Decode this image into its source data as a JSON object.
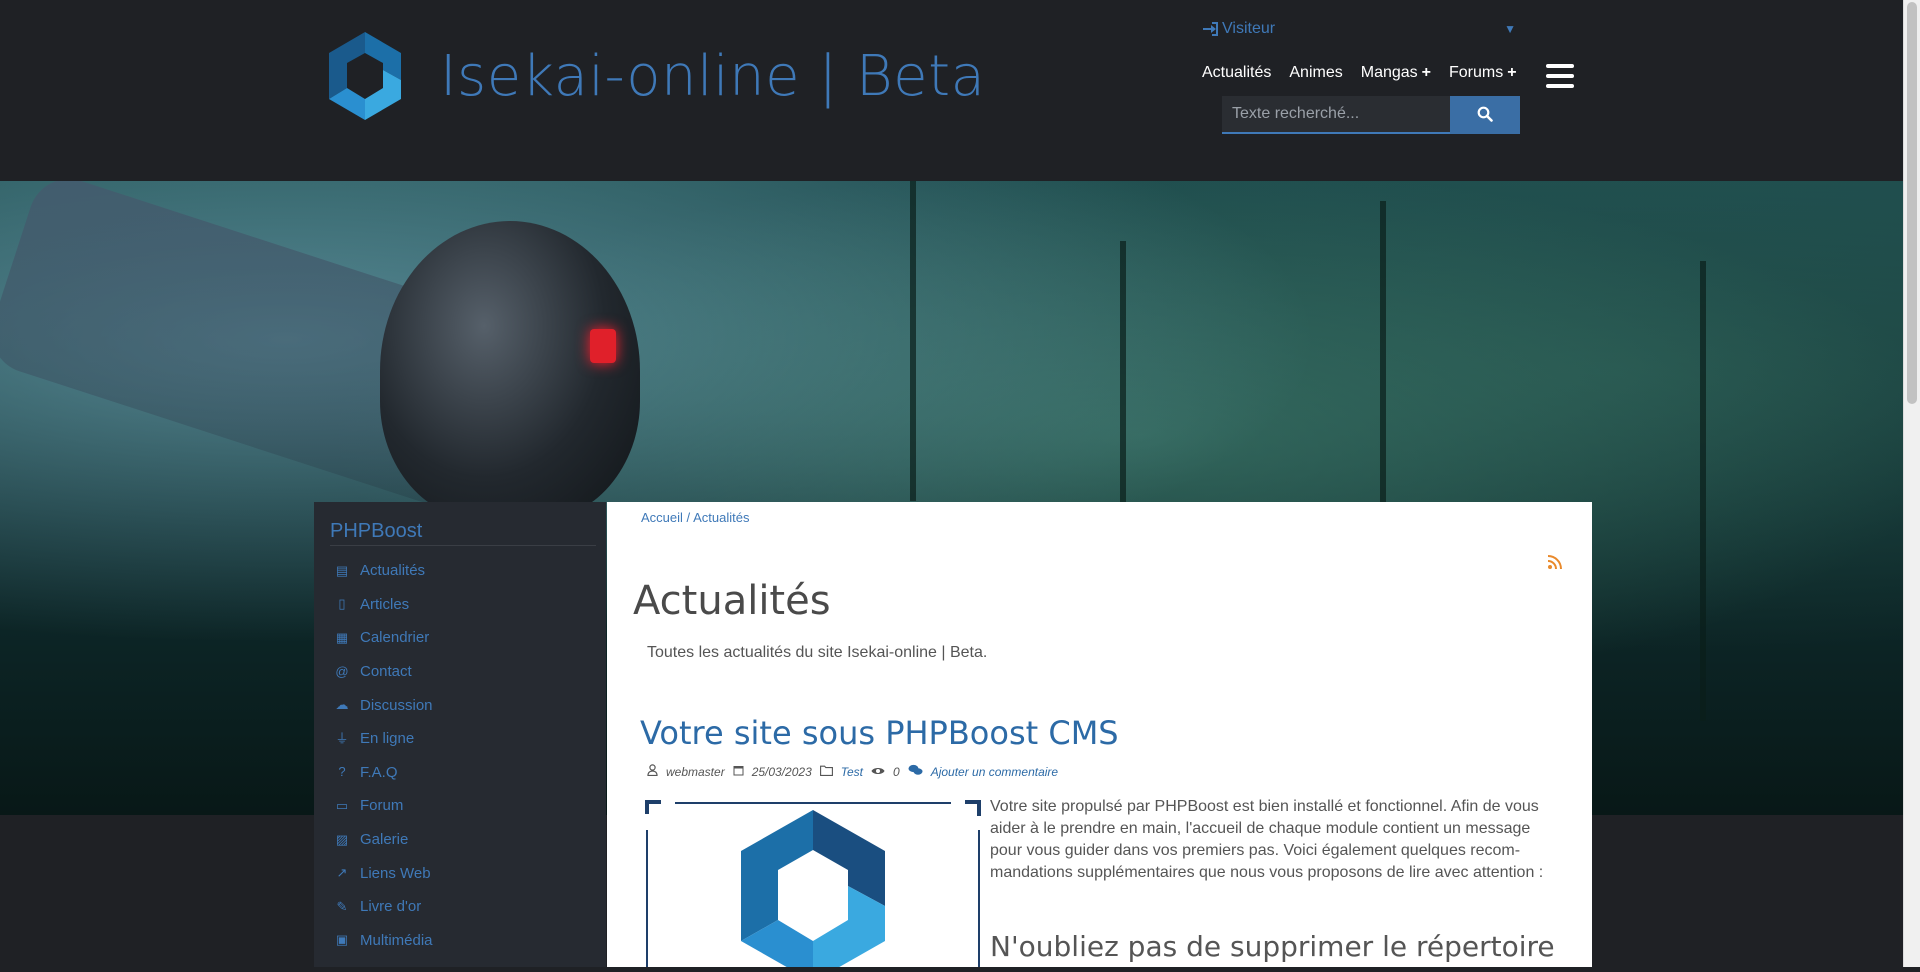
{
  "site": {
    "title": "Isekai-online | Beta"
  },
  "user_menu": {
    "label": "Visiteur"
  },
  "topnav": [
    {
      "label": "Actualités",
      "plus": ""
    },
    {
      "label": "Animes",
      "plus": ""
    },
    {
      "label": "Mangas",
      "plus": "+"
    },
    {
      "label": "Forums",
      "plus": "+"
    }
  ],
  "search": {
    "placeholder": "Texte recherché..."
  },
  "sidebar": {
    "title": "PHPBoost",
    "items": [
      {
        "label": "Actualités",
        "icon": "newspaper-icon"
      },
      {
        "label": "Articles",
        "icon": "file-icon"
      },
      {
        "label": "Calendrier",
        "icon": "calendar-icon"
      },
      {
        "label": "Contact",
        "icon": "at-icon"
      },
      {
        "label": "Discussion",
        "icon": "comments-icon"
      },
      {
        "label": "En ligne",
        "icon": "plug-icon"
      },
      {
        "label": "F.A.Q",
        "icon": "question-icon"
      },
      {
        "label": "Forum",
        "icon": "forum-icon"
      },
      {
        "label": "Galerie",
        "icon": "image-icon"
      },
      {
        "label": "Liens Web",
        "icon": "external-link-icon"
      },
      {
        "label": "Livre d'or",
        "icon": "signature-icon"
      },
      {
        "label": "Multimédia",
        "icon": "film-icon"
      }
    ]
  },
  "breadcrumb": {
    "home": "Accueil",
    "separator": "/",
    "current": "Actualités"
  },
  "page": {
    "title": "Actualités",
    "intro": "Toutes les actualités du site Isekai-online | Beta."
  },
  "article": {
    "title": "Votre site sous PHPBoost CMS",
    "author": "webmaster",
    "date": "25/03/2023",
    "category": "Test",
    "views": "0",
    "comment_link": "Ajouter un commentaire",
    "text": "Votre site propulsé par PHPBoost est bien installé et fonctionnel. Afin de vous aider à le prendre en main, l'accueil de chaque module contient un message pour vous guider dans vos premiers pas. Voici également quelques recom-mandations supplémentaires que nous vous proposons de lire avec attention :",
    "subheading": "N'oubliez pas de supprimer le répertoire"
  },
  "colors": {
    "accent": "#3f79b8",
    "header_bg": "#1f2125",
    "sidebar_bg": "#262a31",
    "rss": "#e98a2c"
  }
}
